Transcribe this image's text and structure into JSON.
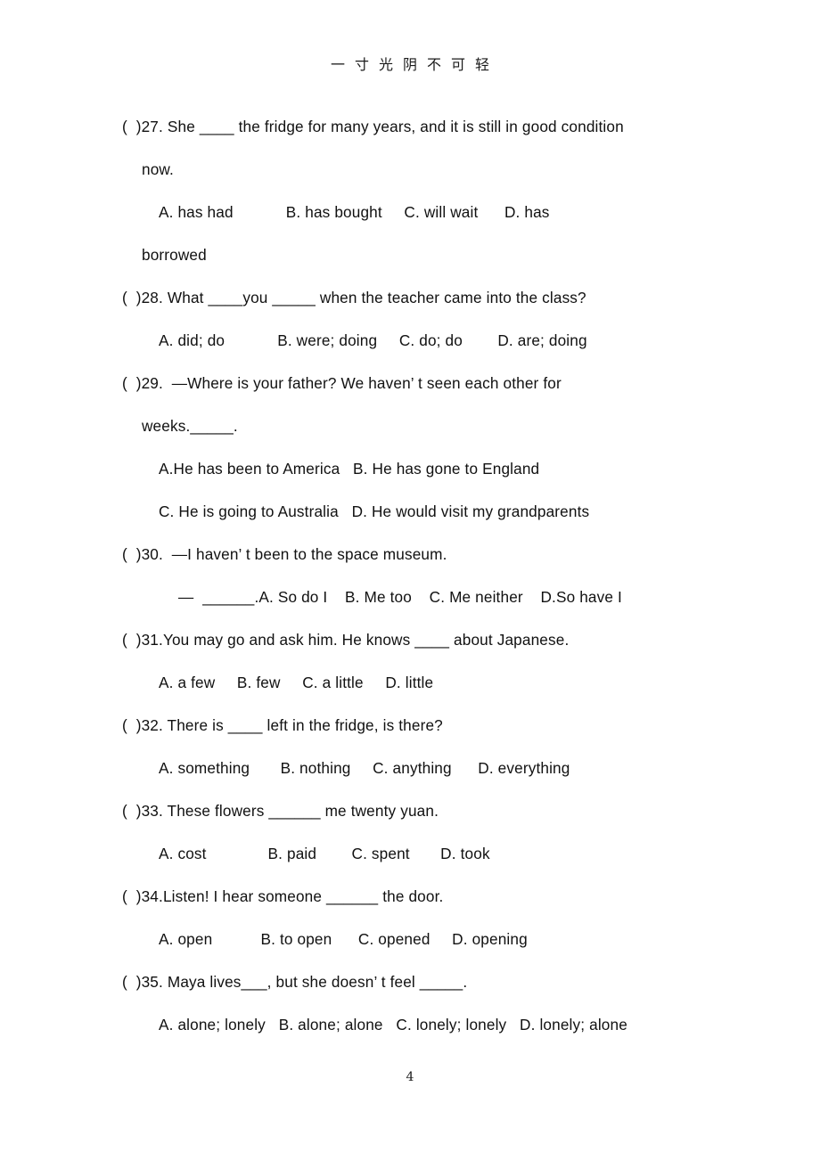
{
  "header": {
    "text": "一寸光阴不可轻"
  },
  "page_number": "4",
  "lines": [
    {
      "indent": "ind-q",
      "text": "(  )27. She ____ the fridge for many years, and it is still in good condition"
    },
    {
      "indent": "ind-wrap",
      "text": "now."
    },
    {
      "indent": "ind-opt",
      "text": "A. has had            B. has bought     C. will wait      D. has"
    },
    {
      "indent": "ind-wrap",
      "text": "borrowed"
    },
    {
      "indent": "ind-q",
      "text": "(  )28. What ____you _____ when the teacher came into the class?"
    },
    {
      "indent": "ind-opt",
      "text": "A. did; do            B. were; doing     C. do; do        D. are; doing"
    },
    {
      "indent": "ind-q",
      "text": "(  )29.  —Where is your father? We haven’ t seen each other for"
    },
    {
      "indent": "ind-wrap",
      "text": "weeks._____."
    },
    {
      "indent": "ind-opt",
      "text": "A.He has been to America   B. He has gone to England"
    },
    {
      "indent": "ind-opt",
      "text": "C. He is going to Australia   D. He would visit my grandparents"
    },
    {
      "indent": "ind-q",
      "text": "(  )30.  —I haven’ t been to the space museum."
    },
    {
      "indent": "ind-deep",
      "text": "—  ______.A. So do I    B. Me too    C. Me neither    D.So have I"
    },
    {
      "indent": "ind-q",
      "text": "(  )31.You may go and ask him. He knows ____ about Japanese."
    },
    {
      "indent": "ind-opt",
      "text": "A. a few     B. few     C. a little     D. little"
    },
    {
      "indent": "ind-q",
      "text": "(  )32. There is ____ left in the fridge, is there?"
    },
    {
      "indent": "ind-opt",
      "text": "A. something       B. nothing     C. anything      D. everything"
    },
    {
      "indent": "ind-q",
      "text": "(  )33. These flowers ______ me twenty yuan."
    },
    {
      "indent": "ind-opt",
      "text": "A. cost              B. paid        C. spent       D. took"
    },
    {
      "indent": "ind-q",
      "text": "(  )34.Listen! I hear someone ______ the door."
    },
    {
      "indent": "ind-opt",
      "text": "A. open           B. to open      C. opened     D. opening"
    },
    {
      "indent": "ind-q",
      "text": "(  )35. Maya lives___, but she doesn’ t feel _____."
    },
    {
      "indent": "ind-opt",
      "text": "A. alone; lonely   B. alone; alone   C. lonely; lonely   D. lonely; alone"
    }
  ]
}
